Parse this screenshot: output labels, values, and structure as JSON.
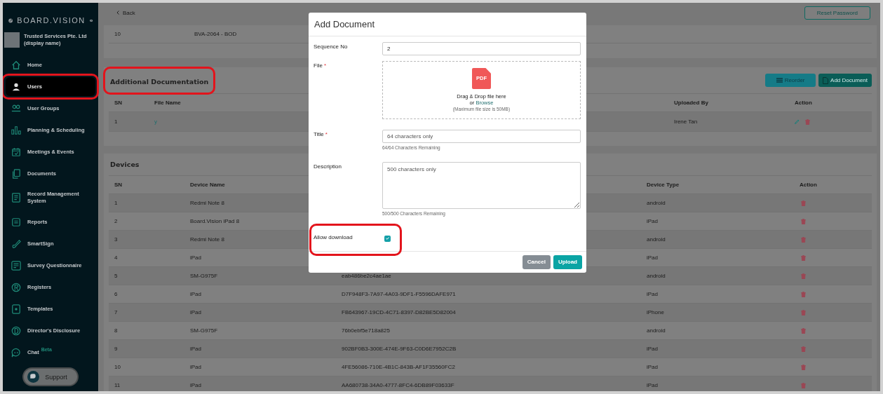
{
  "sidebar": {
    "brand": "BOARD.VISION",
    "org": {
      "name": "Trusted Services Pte. Ltd",
      "note": "(display name)"
    },
    "items": [
      {
        "label": "Home",
        "selected": false,
        "highlighted": false
      },
      {
        "label": "Users",
        "selected": true,
        "highlighted": true
      },
      {
        "label": "User Groups",
        "selected": false,
        "highlighted": false
      },
      {
        "label": "Planning & Scheduling",
        "selected": false,
        "highlighted": false
      },
      {
        "label": "Meetings & Events",
        "selected": false,
        "highlighted": false
      },
      {
        "label": "Documents",
        "selected": false,
        "highlighted": false
      },
      {
        "label": "Record Management System",
        "selected": false,
        "highlighted": false
      },
      {
        "label": "Reports",
        "selected": false,
        "highlighted": false
      },
      {
        "label": "SmartSign",
        "selected": false,
        "highlighted": false
      },
      {
        "label": "Survey Questionnaire",
        "selected": false,
        "highlighted": false
      },
      {
        "label": "Registers",
        "selected": false,
        "highlighted": false
      },
      {
        "label": "Templates",
        "selected": false,
        "highlighted": false
      },
      {
        "label": "Director's Disclosure",
        "selected": false,
        "highlighted": false
      },
      {
        "label": "Chat",
        "badge": "Beta",
        "selected": false,
        "highlighted": false
      }
    ],
    "support": "Support"
  },
  "topbar": {
    "back": "Back",
    "reset_button": "Reset Password"
  },
  "summary_table": {
    "rows": [
      {
        "sn": "10",
        "name": "BVA-2064 - BOD"
      }
    ]
  },
  "documentation": {
    "title": "Additional Documentation",
    "highlighted": true,
    "buttons": [
      {
        "label": "Reorder",
        "kind": "reorder"
      },
      {
        "label": "Add Document",
        "kind": "add"
      }
    ],
    "columns": [
      "SN",
      "File Name",
      "Uploaded By",
      "Action"
    ],
    "rows": [
      {
        "sn": "1",
        "file": "y",
        "uploaded_by": "Irene Tan"
      }
    ]
  },
  "devices": {
    "title": "Devices",
    "columns": [
      "SN",
      "Device Name",
      "Device Type",
      "Action"
    ],
    "rows": [
      {
        "sn": "1",
        "name": "Redmi Note 8",
        "type": "android"
      },
      {
        "sn": "2",
        "name": "Board.Vision iPad 8",
        "type": "iPad"
      },
      {
        "sn": "3",
        "name": "Redmi Note 8",
        "type": "android"
      },
      {
        "sn": "4",
        "name": "iPad",
        "type": "iPad"
      },
      {
        "sn": "5",
        "name": "SM-G975F",
        "id": "eab486be2c4ae1ae",
        "type": "android"
      },
      {
        "sn": "6",
        "name": "iPad",
        "id": "D7F948F3-7A97-4A03-9DF1-F5596DAFE971",
        "type": "iPad"
      },
      {
        "sn": "7",
        "name": "iPad",
        "id": "FB643967-19CD-4C71-8397-D82BE5D82004",
        "type": "iPhone"
      },
      {
        "sn": "8",
        "name": "SM-G975F",
        "id": "76b0ebf5e718a825",
        "type": "android"
      },
      {
        "sn": "9",
        "name": "iPad",
        "id": "902BF0B3-300E-474E-9F63-C0D6E7952C2B",
        "type": "iPad"
      },
      {
        "sn": "10",
        "name": "iPad",
        "id": "4FE56086-710E-4B1C-843B-AF1F35560FC2",
        "type": "iPad"
      },
      {
        "sn": "11",
        "name": "iPad",
        "id": "AA680738-34A0-4777-8FC4-6DB89F03633F",
        "type": "iPad"
      }
    ]
  },
  "modal": {
    "title": "Add Document",
    "fields": [
      {
        "kind": "input",
        "label": "Sequence No",
        "value": "2"
      },
      {
        "kind": "file",
        "label": "File",
        "mark": "*",
        "badge": "PDF",
        "prompt": "Drag & Drop file here",
        "or": "or",
        "link": "Browse",
        "limit": "(Maximum file size is 50MB)"
      },
      {
        "kind": "input",
        "label": "Title",
        "mark": "*",
        "placeholder": "64 characters only",
        "hint": "64/64 Characters Remaining"
      },
      {
        "kind": "textarea",
        "label": "Description",
        "placeholder": "500 characters only",
        "hint": "500/500 Characters Remaining"
      },
      {
        "kind": "checkbox",
        "label": "Allow download",
        "checked": true,
        "highlighted": true
      }
    ],
    "buttons": [
      {
        "label": "Cancel",
        "kind": "secondary"
      },
      {
        "label": "Upload",
        "kind": "primary"
      }
    ]
  }
}
